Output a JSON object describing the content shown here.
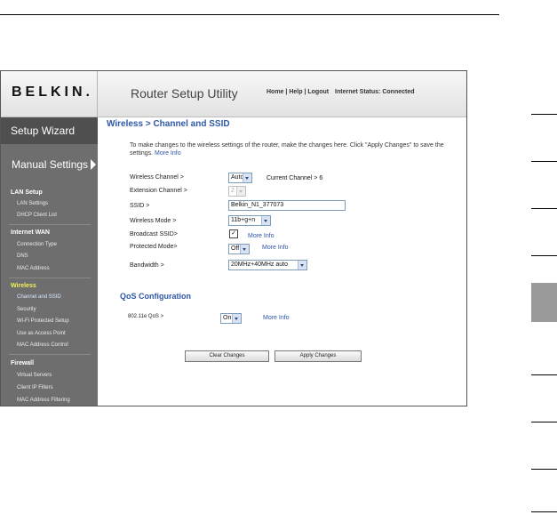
{
  "header": {
    "logo": "BELKIN.",
    "title": "Router Setup Utility",
    "nav": {
      "home": "Home",
      "help": "Help",
      "logout": "Logout",
      "sep": "|",
      "status_label": "Internet Status:",
      "status_value": "Connected"
    }
  },
  "sidebar": {
    "setup_wizard": "Setup Wizard",
    "manual_settings": "Manual Settings",
    "sections": {
      "lan": {
        "title": "LAN Setup",
        "items": [
          "LAN Settings",
          "DHCP Client List"
        ]
      },
      "wan": {
        "title": "Internet WAN",
        "items": [
          "Connection Type",
          "DNS",
          "MAC Address"
        ]
      },
      "wireless": {
        "title": "Wireless",
        "items": [
          "Channel and SSID",
          "Security",
          "Wi-Fi Protected Setup",
          "Use as Access Point",
          "MAC Address Control"
        ]
      },
      "firewall": {
        "title": "Firewall",
        "items": [
          "Virtual Servers",
          "Client IP Filters",
          "MAC Address Filtering"
        ]
      }
    }
  },
  "main": {
    "title": "Wireless > Channel and SSID",
    "intro": "To make changes to the wireless settings of the router, make the changes here. Click \"Apply Changes\" to save the settings.",
    "more_info": "More Info",
    "fields": {
      "channel": {
        "label": "Wireless Channel >",
        "value": "Auto",
        "current": "Current Channel > 6"
      },
      "extension": {
        "label": "Extension Channel >",
        "value": "2"
      },
      "ssid": {
        "label": "SSID >",
        "value": "Belkin_N1_377073"
      },
      "mode": {
        "label": "Wireless Mode >",
        "value": "11b+g+n"
      },
      "broadcast": {
        "label": "Broadcast SSID>",
        "checkmark": "✓"
      },
      "protected": {
        "label": "Protected Mode>",
        "value": "Off"
      },
      "bandwidth": {
        "label": "Bandwidth >",
        "value": "20MHz+40MHz auto"
      }
    },
    "qos": {
      "title": "QoS Configuration",
      "label": "802.11e QoS >",
      "value": "On"
    },
    "buttons": {
      "clear": "Clear Changes",
      "apply": "Apply Changes"
    }
  }
}
